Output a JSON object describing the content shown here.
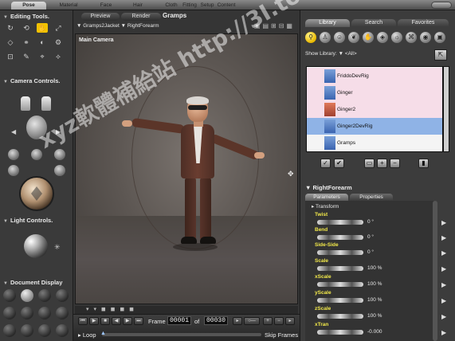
{
  "rooms": [
    "Pose",
    "Material",
    "Face",
    "Hair",
    "Cloth",
    "Fitting",
    "Setup",
    "Content"
  ],
  "left_panel": {
    "editing_tools_title": "Editing Tools.",
    "camera_controls_title": "Camera Controls.",
    "light_controls_title": "Light Controls.",
    "document_display_title": "Document Display"
  },
  "viewport": {
    "tabs": [
      "Preview",
      "Render"
    ],
    "figure_title": "Gramps",
    "breadcrumb_figure": "Gramps2Jacket",
    "breadcrumb_actor": "RightForearm",
    "camera_label": "Main Camera"
  },
  "timeline": {
    "frame_label": "Frame",
    "current_frame": "00001",
    "of_label": "of",
    "total_frames": "00030",
    "loop_label": "Loop",
    "skip_frames_label": "Skip Frames"
  },
  "library": {
    "tabs": [
      "Library",
      "Search",
      "Favorites"
    ],
    "show_library_label": "Show Library:",
    "show_library_value": "<All>",
    "items": [
      {
        "label": "FriddoDevRig",
        "state": "pink"
      },
      {
        "label": "Ginger",
        "state": "pink"
      },
      {
        "label": "Ginger2",
        "state": "pink"
      },
      {
        "label": "Ginger2DevRig",
        "state": "sel"
      },
      {
        "label": "Gramps",
        "state": "plain"
      }
    ]
  },
  "parameters": {
    "actor_title": "RightForearm",
    "tabs": [
      "Parameters",
      "Properties"
    ],
    "group": "Transform",
    "dials": [
      {
        "name": "Twist",
        "value": "0 °"
      },
      {
        "name": "Bend",
        "value": "0 °"
      },
      {
        "name": "Side-Side",
        "value": "0 °"
      },
      {
        "name": "Scale",
        "value": "100 %"
      },
      {
        "name": "xScale",
        "value": "100 %"
      },
      {
        "name": "yScale",
        "value": "100 %"
      },
      {
        "name": "zScale",
        "value": "100 %"
      },
      {
        "name": "xTran",
        "value": "-0.000"
      }
    ]
  },
  "watermark": "xyz軟體補給站 http://3I.to",
  "colors": {
    "active_tool": "#f2c200",
    "dial_label": "#f2e94a",
    "library_selected": "#8fb3e6",
    "library_pink": "#f6dde8"
  }
}
